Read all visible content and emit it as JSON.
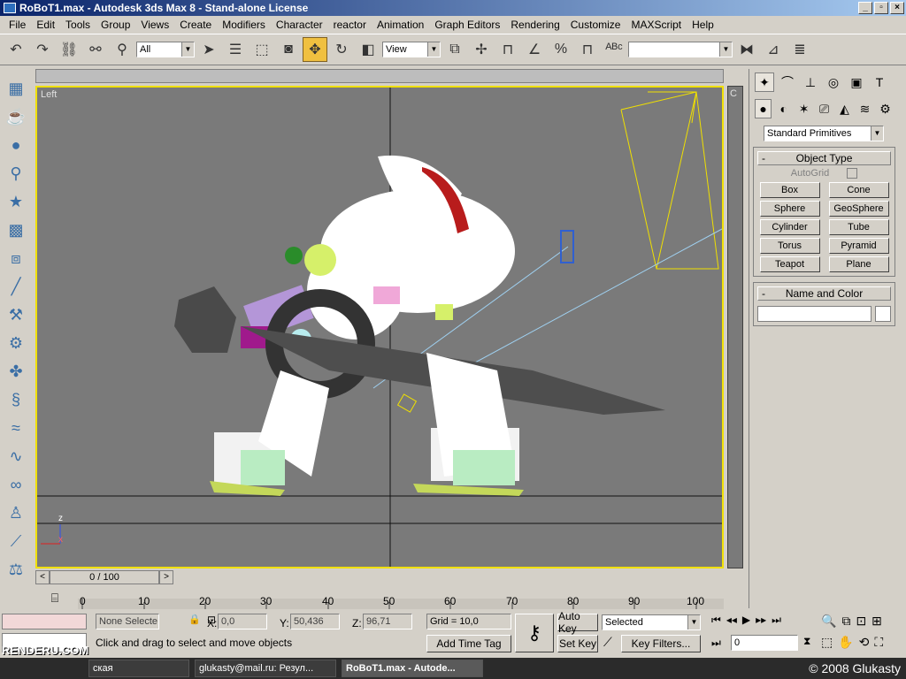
{
  "window": {
    "title": "RoBoT1.max - Autodesk 3ds Max 8  - Stand-alone License"
  },
  "menu": [
    "File",
    "Edit",
    "Tools",
    "Group",
    "Views",
    "Create",
    "Modifiers",
    "Character",
    "reactor",
    "Animation",
    "Graph Editors",
    "Rendering",
    "Customize",
    "MAXScript",
    "Help"
  ],
  "toolbar": {
    "selection_filter": "All",
    "ref_coord": "View",
    "named_sel": ""
  },
  "viewport": {
    "label": "Left",
    "right_label": "C"
  },
  "panel": {
    "dropdown": "Standard Primitives",
    "object_type_title": "Object Type",
    "autogrid": "AutoGrid",
    "buttons": [
      "Box",
      "Cone",
      "Sphere",
      "GeoSphere",
      "Cylinder",
      "Tube",
      "Torus",
      "Pyramid",
      "Teapot",
      "Plane"
    ],
    "name_color_title": "Name and Color",
    "collapse": "-"
  },
  "time": {
    "slider": "0 / 100",
    "ticks": [
      "0",
      "10",
      "20",
      "30",
      "40",
      "50",
      "60",
      "70",
      "80",
      "90",
      "100"
    ]
  },
  "status": {
    "selection": "None Selecte",
    "x_label": "X:",
    "x_value": "0,0",
    "y_label": "Y:",
    "y_value": "50,436",
    "z_label": "Z:",
    "z_value": "96,71",
    "grid": "Grid = 10,0",
    "prompt": "Click and drag to select and move objects",
    "add_time_tag": "Add Time Tag",
    "auto_key": "Auto Key",
    "set_key": "Set Key",
    "key_mode": "Selected",
    "key_filters": "Key Filters...",
    "frame": "0"
  },
  "taskbar": {
    "items": [
      "ская",
      "glukasty@mail.ru: Резул...",
      "RoBoT1.max - Autode..."
    ],
    "logo": "RENDERU.COM",
    "copyright": "© 2008 Glukasty"
  },
  "colors": {
    "active_viewport": "#f0e000",
    "title_start": "#0a246a",
    "accent_red": "#b81c1c"
  }
}
